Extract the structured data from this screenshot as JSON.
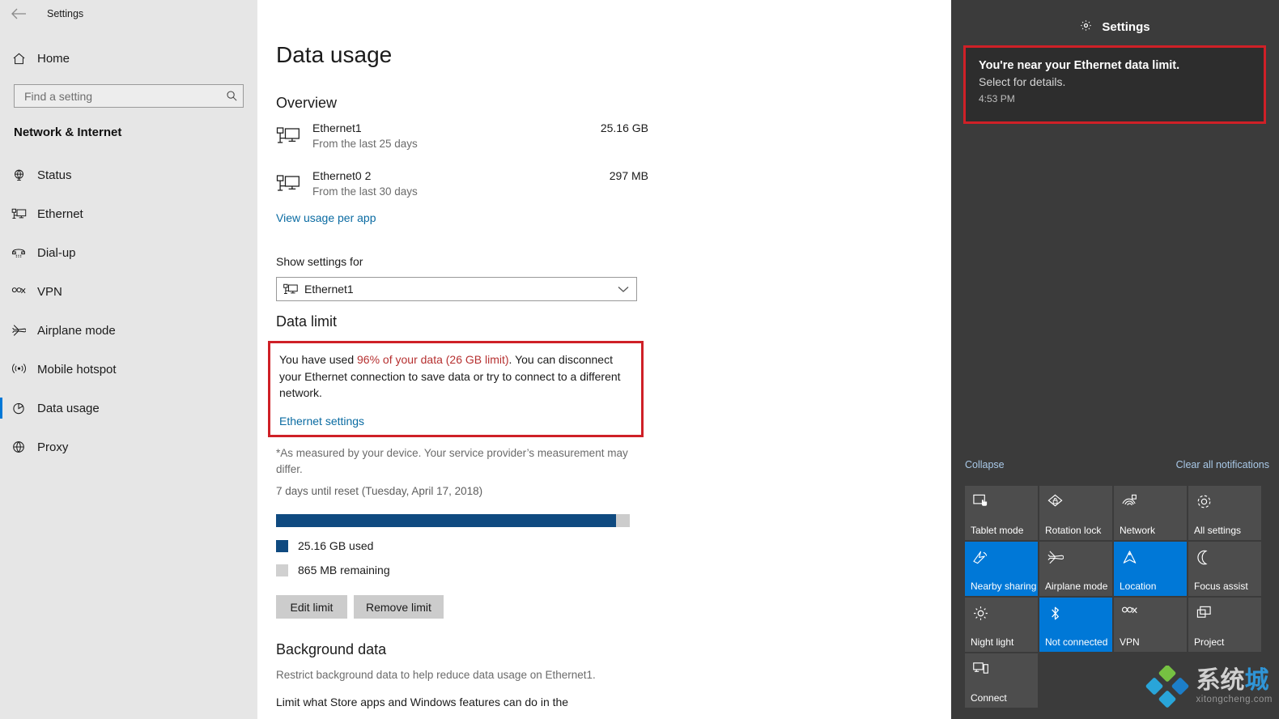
{
  "window": {
    "title": "Settings",
    "back_icon": "back-arrow-icon"
  },
  "sidebar": {
    "home_label": "Home",
    "home_icon": "home-icon",
    "search": {
      "placeholder": "Find a setting",
      "value": "",
      "icon": "search-icon"
    },
    "category": "Network & Internet",
    "items": [
      {
        "label": "Status",
        "icon": "globe-status-icon",
        "active": false
      },
      {
        "label": "Ethernet",
        "icon": "ethernet-icon",
        "active": false
      },
      {
        "label": "Dial-up",
        "icon": "dialup-phone-icon",
        "active": false
      },
      {
        "label": "VPN",
        "icon": "vpn-icon",
        "active": false
      },
      {
        "label": "Airplane mode",
        "icon": "airplane-icon",
        "active": false
      },
      {
        "label": "Mobile hotspot",
        "icon": "hotspot-icon",
        "active": false
      },
      {
        "label": "Data usage",
        "icon": "data-usage-pie-icon",
        "active": true
      },
      {
        "label": "Proxy",
        "icon": "proxy-globe-icon",
        "active": false
      }
    ]
  },
  "main": {
    "page_title": "Data usage",
    "overview": {
      "heading": "Overview",
      "rows": [
        {
          "name": "Ethernet1",
          "subtitle": "From the last 25 days",
          "amount": "25.16 GB",
          "icon": "ethernet-icon"
        },
        {
          "name": "Ethernet0 2",
          "subtitle": "From the last 30 days",
          "amount": "297 MB",
          "icon": "ethernet-icon"
        }
      ],
      "link": "View usage per app"
    },
    "show_settings_for": {
      "label": "Show settings for",
      "selected": "Ethernet1",
      "icon": "ethernet-icon",
      "chevron": "chevron-down-icon",
      "options": [
        "Ethernet1",
        "Ethernet0 2"
      ]
    },
    "data_limit": {
      "heading": "Data limit",
      "warning_prefix": "You have used ",
      "warning_highlight": "96% of your data (26 GB limit)",
      "warning_suffix": ". You can disconnect your Ethernet connection to save data or try to connect to a different network.",
      "warning_link": "Ethernet settings",
      "highlight_color": "#b63030",
      "box_border_color": "#cf2027"
    },
    "measured_note": "*As measured by your device. Your service provider’s measurement may differ.",
    "reset_note": "7 days until reset (Tuesday, April 17, 2018)",
    "legend": {
      "used": "25.16 GB used",
      "remaining": "865 MB remaining",
      "used_color": "#0f4a80",
      "remaining_color": "#d0d0d0"
    },
    "buttons": [
      {
        "label": "Edit limit"
      },
      {
        "label": "Remove limit"
      }
    ],
    "background_data": {
      "heading": "Background data",
      "subtitle": "Restrict background data to help reduce data usage on Ethernet1.",
      "line": "Limit what Store apps and Windows features can do in the"
    }
  },
  "chart_data": {
    "type": "bar",
    "title": "Data limit usage",
    "categories": [
      "Used",
      "Remaining"
    ],
    "values": [
      25.16,
      0.865
    ],
    "unit": "GB",
    "percent_used": 96,
    "limit_gb": 26,
    "colors": [
      "#0f4a80",
      "#d0d0d0"
    ]
  },
  "action_center": {
    "header": {
      "title": "Settings",
      "icon": "gear-icon"
    },
    "notification": {
      "title": "You're near your Ethernet data limit.",
      "body": "Select for details.",
      "time": "4:53 PM",
      "highlight_border": "#cf2027"
    },
    "collapse_label": "Collapse",
    "clear_all_label": "Clear all notifications",
    "accent_color": "#0078d7",
    "tiles": [
      {
        "label": "Tablet mode",
        "icon": "tablet-mode-icon",
        "on": false
      },
      {
        "label": "Rotation lock",
        "icon": "rotation-lock-icon",
        "on": false
      },
      {
        "label": "Network",
        "icon": "network-wifi-icon",
        "on": false
      },
      {
        "label": "All settings",
        "icon": "gear-icon",
        "on": false
      },
      {
        "label": "Nearby sharing",
        "icon": "nearby-sharing-icon",
        "on": true
      },
      {
        "label": "Airplane mode",
        "icon": "airplane-icon",
        "on": false
      },
      {
        "label": "Location",
        "icon": "location-icon",
        "on": true
      },
      {
        "label": "Focus assist",
        "icon": "moon-icon",
        "on": false
      },
      {
        "label": "Night light",
        "icon": "brightness-sun-icon",
        "on": false
      },
      {
        "label": "Not connected",
        "icon": "bluetooth-icon",
        "on": true
      },
      {
        "label": "VPN",
        "icon": "vpn-icon",
        "on": false
      },
      {
        "label": "Project",
        "icon": "project-screen-icon",
        "on": false
      },
      {
        "label": "Connect",
        "icon": "connect-device-icon",
        "on": false
      }
    ]
  },
  "watermark": {
    "text_dark": "系统",
    "text_accent": "城",
    "url": "xitongcheng.com"
  }
}
